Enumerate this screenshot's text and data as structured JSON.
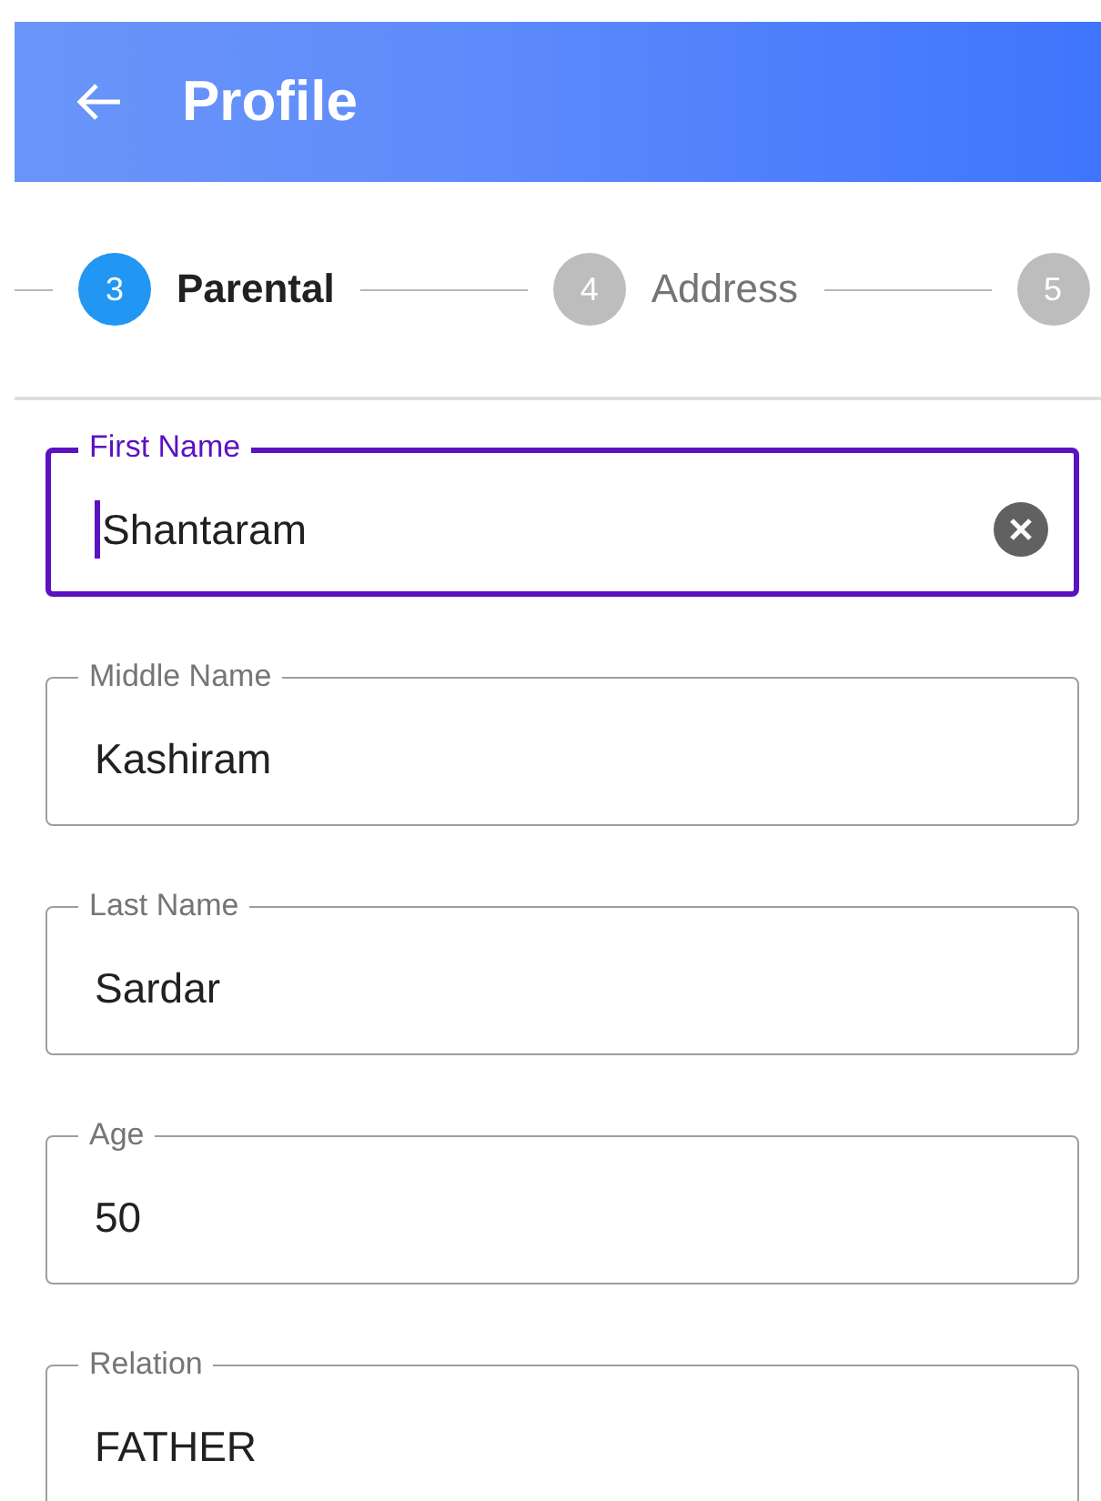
{
  "header": {
    "title": "Profile"
  },
  "steps": [
    {
      "number": "3",
      "label": "Parental",
      "selected": true
    },
    {
      "number": "4",
      "label": "Address",
      "selected": false
    },
    {
      "number": "5",
      "selected": false
    }
  ],
  "fields": [
    {
      "label": "First Name",
      "value": "Shantaram",
      "focused": true
    },
    {
      "label": "Middle Name",
      "value": "Kashiram",
      "focused": false
    },
    {
      "label": "Last Name",
      "value": "Sardar",
      "focused": false
    },
    {
      "label": "Age",
      "value": "50",
      "focused": false
    },
    {
      "label": "Relation",
      "value": "FATHER",
      "focused": false
    }
  ]
}
